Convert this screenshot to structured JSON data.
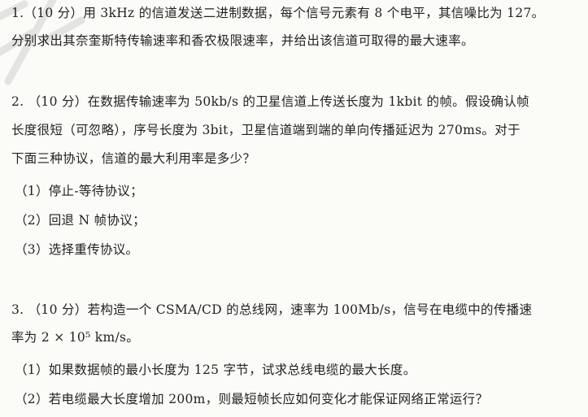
{
  "questions": [
    {
      "lines": [
        "1.（10 分）用 3kHz 的信道发送二进制数据，每个信号元素有 8 个电平，其信噪比为 127。",
        "分别求出其奈奎斯特传输速率和香农极限速率，并给出该信道可取得的最大速率。"
      ]
    },
    {
      "lines": [
        "2. （10 分）在数据传输速率为 50kb/s 的卫星信道上传送长度为 1kbit 的帧。假设确认帧",
        "长度很短（可忽略），序号长度为 3bit，卫星信道端到端的单向传播延迟为 270ms。对于",
        "下面三种协议，信道的最大利用率是多少？"
      ],
      "items": [
        "（1）停止-等待协议；",
        "（2）回退 N 帧协议；",
        "（3）选择重传协议。"
      ]
    },
    {
      "lines": [
        "3. （10 分）若构造一个 CSMA/CD 的总线网，速率为 100Mb/s，信号在电缆中的传播速",
        "率为 2 × 10⁵ km/s。"
      ],
      "items": [
        "（1）如果数据帧的最小长度为 125 字节，试求总线电缆的最大长度。",
        "（2）若电缆最大长度增加 200m，则最短帧长应如何变化才能保证网络正常运行？"
      ]
    }
  ]
}
